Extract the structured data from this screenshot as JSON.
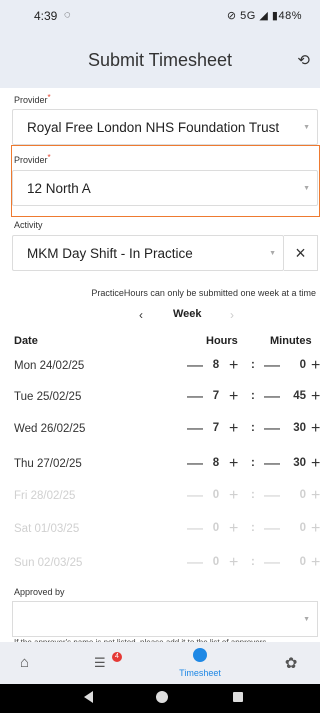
{
  "status_bar": {
    "time": "4:39",
    "whatsapp_icon": "whatsapp-icon",
    "network": "5G",
    "battery": "48%"
  },
  "appbar": {
    "title": "Submit Timesheet",
    "refresh_icon": "refresh-icon"
  },
  "provider1": {
    "label": "Provider",
    "required": "*",
    "value": "Royal Free London NHS Foundation Trust"
  },
  "provider2": {
    "label": "Provider",
    "required": "*",
    "value": "12 North A"
  },
  "activity": {
    "label": "Activity",
    "value": "MKM Day Shift - In Practice",
    "clear": "×"
  },
  "note": "PracticeHours can only be submitted one week at a time",
  "week": {
    "prev": "‹",
    "label": "Week",
    "next": "›"
  },
  "table": {
    "headers": [
      "Date",
      "Hours",
      "Minutes"
    ],
    "rows": [
      {
        "day": "Mon 24/02/25",
        "hours": "8",
        "minutes": "0"
      },
      {
        "day": "Tue  25/02/25",
        "hours": "7",
        "minutes": "45"
      },
      {
        "day": "Wed 26/02/25",
        "hours": "7",
        "minutes": "30"
      },
      {
        "day": "Thu  27/02/25",
        "hours": "8",
        "minutes": "30"
      },
      {
        "day": "Fri   28/02/25",
        "hours": "0",
        "minutes": "0"
      },
      {
        "day": "Sat  01/03/25",
        "hours": "0",
        "minutes": "0"
      },
      {
        "day": "Sun  02/03/25",
        "hours": "0",
        "minutes": "0"
      }
    ],
    "minus": "—",
    "plus": "+",
    "colon": ":"
  },
  "approved_by": {
    "label": "Approved by",
    "value": ""
  },
  "cut_text": "If the approver's name is not listed, please add it to the list of approvers",
  "bottom_nav": {
    "home_icon": "home-icon",
    "messages_badge": "4",
    "timesheet_label": "Timesheet",
    "settings_icon": "settings-icon"
  },
  "colors": {
    "accent": "#1e88e5",
    "highlight": "#ee7a30",
    "required": "#e2402c",
    "appbar": "#e9edf4"
  }
}
